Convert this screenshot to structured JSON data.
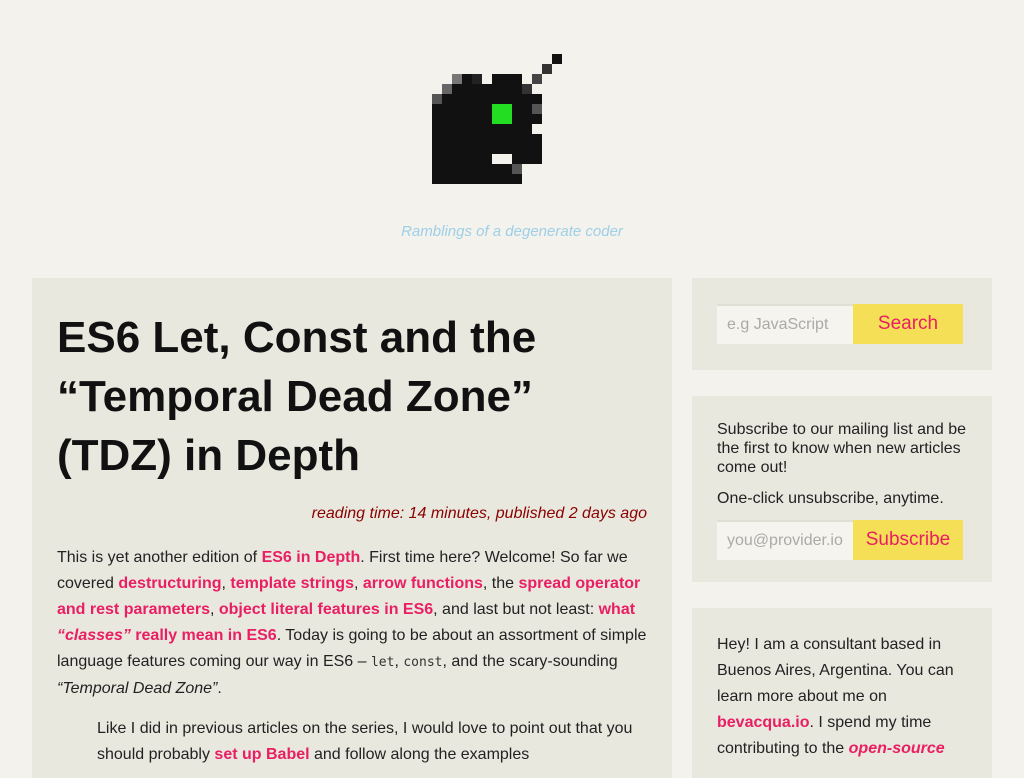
{
  "header": {
    "tagline": "Ramblings of a degenerate coder"
  },
  "article": {
    "title": "ES6 Let, Const and the “Temporal Dead Zone” (TDZ) in Depth",
    "meta": "reading time: 14 minutes, published 2 days ago",
    "intro": {
      "t1": "This is yet another edition of ",
      "l1": "ES6 in Depth",
      "t2": ". First time here? Welcome! So far we covered ",
      "l2": "destructuring",
      "t3": ", ",
      "l3": "template strings",
      "t4": ", ",
      "l4": "arrow functions",
      "t5": ", the ",
      "l5": "spread operator and rest parameters",
      "t6": ", ",
      "l6": "object literal features in ES6",
      "t7": ", and last but not least: ",
      "l7a": "what ",
      "l7b": "“classes”",
      "l7c": " really mean in ES6",
      "t8": ". Today is going to be about an assortment of simple language features coming our way in ES6 – ",
      "c1": "let",
      "t9": ", ",
      "c2": "const",
      "t10": ", and the scary-sounding ",
      "em1": "“Temporal Dead Zone”",
      "t11": "."
    },
    "quote": {
      "t1": "Like I did in previous articles on the series, I would love to point out that you should probably ",
      "l1": "set up Babel",
      "t2": " and follow along the examples"
    }
  },
  "sidebar": {
    "search": {
      "placeholder": "e.g JavaScript",
      "button": "Search"
    },
    "subscribe": {
      "text1": "Subscribe to our mailing list and be the first to know when new articles come out!",
      "text2": "One-click unsubscribe, anytime.",
      "placeholder": "you@provider.io",
      "button": "Subscribe"
    },
    "about": {
      "t1": "Hey! I am a consultant based in Buenos Aires, Argentina. You can learn more about me on ",
      "l1": "bevacqua.io",
      "t2": ". I spend my time contributing to the ",
      "l2": "open-source"
    }
  },
  "colors": {
    "link": "#e91e63",
    "button_bg": "#f4df56",
    "meta": "#8b0000",
    "tagline": "#9ecfe8",
    "panel": "#e9e8df",
    "page": "#f3f2ec",
    "logo_eye": "#22dd22"
  },
  "icons": {
    "logo": "pixel-creature-logo-icon"
  }
}
